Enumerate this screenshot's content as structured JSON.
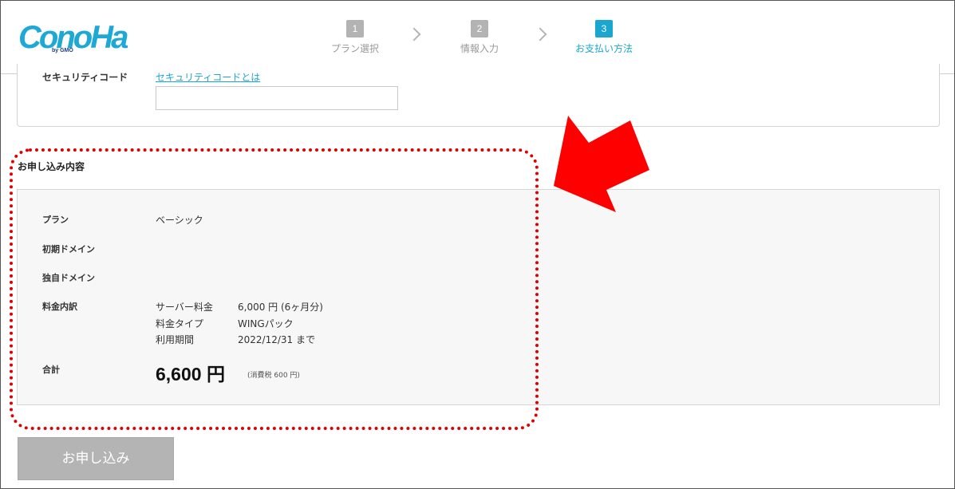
{
  "brand": {
    "logo_text": "ConoHa",
    "logo_sub": "by GMO"
  },
  "steps": [
    {
      "num": "1",
      "label": "プラン選択",
      "active": false
    },
    {
      "num": "2",
      "label": "情報入力",
      "active": false
    },
    {
      "num": "3",
      "label": "お支払い方法",
      "active": true
    }
  ],
  "security": {
    "label": "セキュリティコード",
    "link": "セキュリティコードとは",
    "value": ""
  },
  "summary": {
    "title": "お申し込み内容",
    "plan_label": "プラン",
    "plan_value": "ベーシック",
    "initial_domain_label": "初期ドメイン",
    "own_domain_label": "独自ドメイン",
    "breakdown_label": "料金内訳",
    "breakdown": [
      {
        "key": "サーバー料金",
        "value": "6,000 円 (6ヶ月分)"
      },
      {
        "key": "料金タイプ",
        "value": "WINGパック"
      },
      {
        "key": "利用期間",
        "value": "2022/12/31 まで"
      }
    ],
    "total_label": "合計",
    "total_value": "6,600 円",
    "total_tax": "(消費税 600 円)"
  },
  "submit_label": "お申し込み",
  "colors": {
    "accent": "#19a7cf",
    "highlight": "#e00000",
    "arrow": "#ff0000",
    "disabled": "#b4b4b4"
  }
}
